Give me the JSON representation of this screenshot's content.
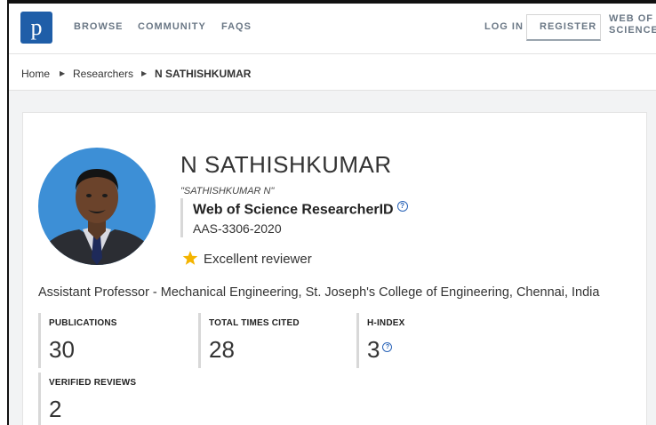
{
  "nav": {
    "logo_letter": "p",
    "browse": "BROWSE",
    "community": "COMMUNITY",
    "faqs": "FAQS",
    "login": "LOG IN",
    "register": "REGISTER",
    "wos_line1": "WEB OF",
    "wos_line2": "SCIENCE",
    "logo_color": "#1f5ea8"
  },
  "breadcrumb": {
    "home": "Home",
    "researchers": "Researchers",
    "current": "N SATHISHKUMAR"
  },
  "profile": {
    "name": "N SATHISHKUMAR",
    "alias": "\"SATHISHKUMAR N\"",
    "researcher_id_label": "Web of Science ResearcherID",
    "researcher_id": "AAS-3306-2020",
    "badge": "Excellent reviewer",
    "affiliation": "Assistant Professor - Mechanical Engineering, St. Joseph's College of Engineering, Chennai, India"
  },
  "metrics": [
    {
      "label": "PUBLICATIONS",
      "value": "30"
    },
    {
      "label": "TOTAL TIMES CITED",
      "value": "28"
    },
    {
      "label": "H-INDEX",
      "value": "3"
    },
    {
      "label": "VERIFIED REVIEWS",
      "value": "2"
    }
  ],
  "icons": {
    "star": "star-icon",
    "help": "help-circle-icon",
    "chevron": "chevron-right-icon"
  }
}
